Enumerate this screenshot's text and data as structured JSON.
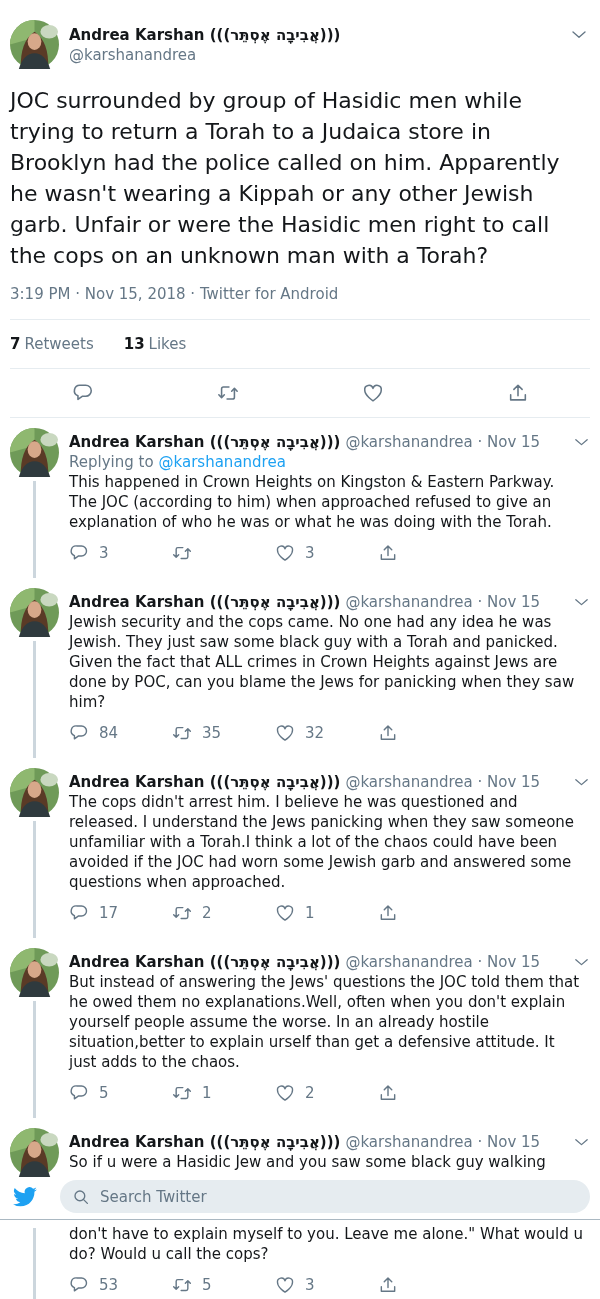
{
  "main_tweet": {
    "author": {
      "name": "Andrea Karshan (((אֲבִיבָה אֶסְתֵּר)))",
      "handle": "@karshanandrea"
    },
    "text": "JOC surrounded by group of Hasidic men while trying to return a Torah to a Judaica store in Brooklyn had the police called on him. Apparently he wasn't wearing a Kippah or any other Jewish garb. Unfair or were the Hasidic men right to call the cops on an unknown man with a Torah?",
    "meta": "3:19 PM · Nov 15, 2018 · Twitter for Android",
    "stats": [
      {
        "count": "7",
        "label": "Retweets"
      },
      {
        "count": "13",
        "label": "Likes"
      }
    ]
  },
  "replies": [
    {
      "name": "Andrea Karshan (((אֲבִיבָה אֶסְתֵּר)))",
      "byline": "@karshanandrea · Nov 15",
      "replying_to": {
        "label": "Replying to",
        "handle": "@karshanandrea"
      },
      "text": "This happened in Crown Heights on Kingston & Eastern Parkway. The JOC (according to him) when approached refused to give an explanation of who he was or what he was doing with the Torah.",
      "replies": "3",
      "likes": "3"
    },
    {
      "name": "Andrea Karshan (((אֲבִיבָה אֶסְתֵּר)))",
      "byline": "@karshanandrea · Nov 15",
      "text": "Jewish security and the cops came. No one had any idea he was Jewish. They just saw some black guy with a Torah and panicked. Given the fact that ALL crimes in Crown Heights against Jews are done by POC, can you blame the Jews for panicking when they saw him?",
      "replies": "84",
      "retweets": "35",
      "likes": "32"
    },
    {
      "name": "Andrea Karshan (((אֲבִיבָה אֶסְתֵּר)))",
      "byline": "@karshanandrea · Nov 15",
      "text": "The cops didn't arrest him. I believe he was questioned and released. I understand the Jews panicking when they saw someone unfamiliar with a Torah.I think a lot of the chaos could have been avoided if the JOC had worn some Jewish garb and answered some questions when approached.",
      "replies": "17",
      "retweets": "2",
      "likes": "1"
    },
    {
      "name": "Andrea Karshan (((אֲבִיבָה אֶסְתֵּר)))",
      "byline": "@karshanandrea · Nov 15",
      "text": "But instead of answering the Jews' questions the JOC told them that he owed them no explanations.Well, often when you don't explain yourself people assume the worse. In an already hostile situation,better to explain urself than get a defensive attitude. It just adds to the chaos.",
      "replies": "5",
      "retweets": "1",
      "likes": "2"
    },
    {
      "name": "Andrea Karshan (((אֲבִיבָה אֶסְתֵּר)))",
      "byline": "@karshanandrea · Nov 15",
      "text_top": "So if u were a Hasidic Jew and you saw some black guy walking",
      "text_bottom": "don't have to explain myself to you. Leave me alone.\" What would u do? Would u call the cops?",
      "replies": "53",
      "retweets": "5",
      "likes": "3"
    }
  ],
  "search_bar": {
    "placeholder": "Search Twitter"
  }
}
